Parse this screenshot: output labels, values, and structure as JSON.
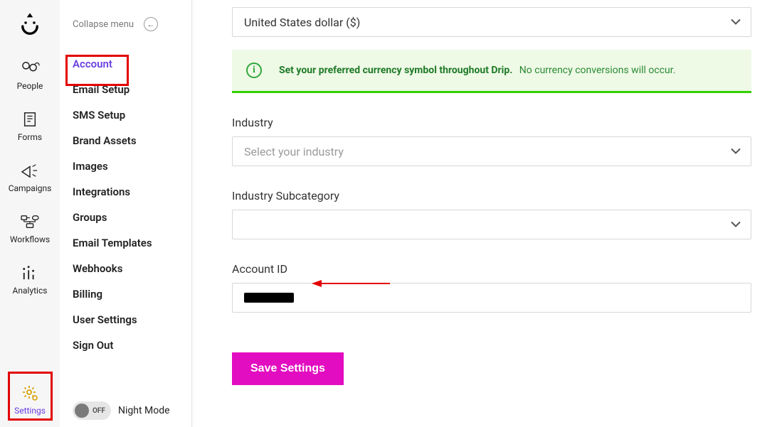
{
  "rail": {
    "items": [
      {
        "label": "People"
      },
      {
        "label": "Forms"
      },
      {
        "label": "Campaigns"
      },
      {
        "label": "Workflows"
      },
      {
        "label": "Analytics"
      },
      {
        "label": "Settings"
      }
    ]
  },
  "submenu": {
    "collapse_label": "Collapse menu",
    "items": [
      "Account",
      "Email Setup",
      "SMS Setup",
      "Brand Assets",
      "Images",
      "Integrations",
      "Groups",
      "Email Templates",
      "Webhooks",
      "Billing",
      "User Settings",
      "Sign Out"
    ],
    "active_index": 0,
    "night_mode": {
      "label": "Night Mode",
      "state": "OFF"
    }
  },
  "main": {
    "currency": {
      "value": "United States dollar ($)"
    },
    "banner": {
      "bold": "Set your preferred currency symbol throughout Drip.",
      "rest": "No currency conversions will occur."
    },
    "industry": {
      "label": "Industry",
      "placeholder": "Select your industry"
    },
    "industry_sub": {
      "label": "Industry Subcategory"
    },
    "account_id": {
      "label": "Account ID",
      "value": "████████"
    },
    "save_label": "Save Settings"
  }
}
